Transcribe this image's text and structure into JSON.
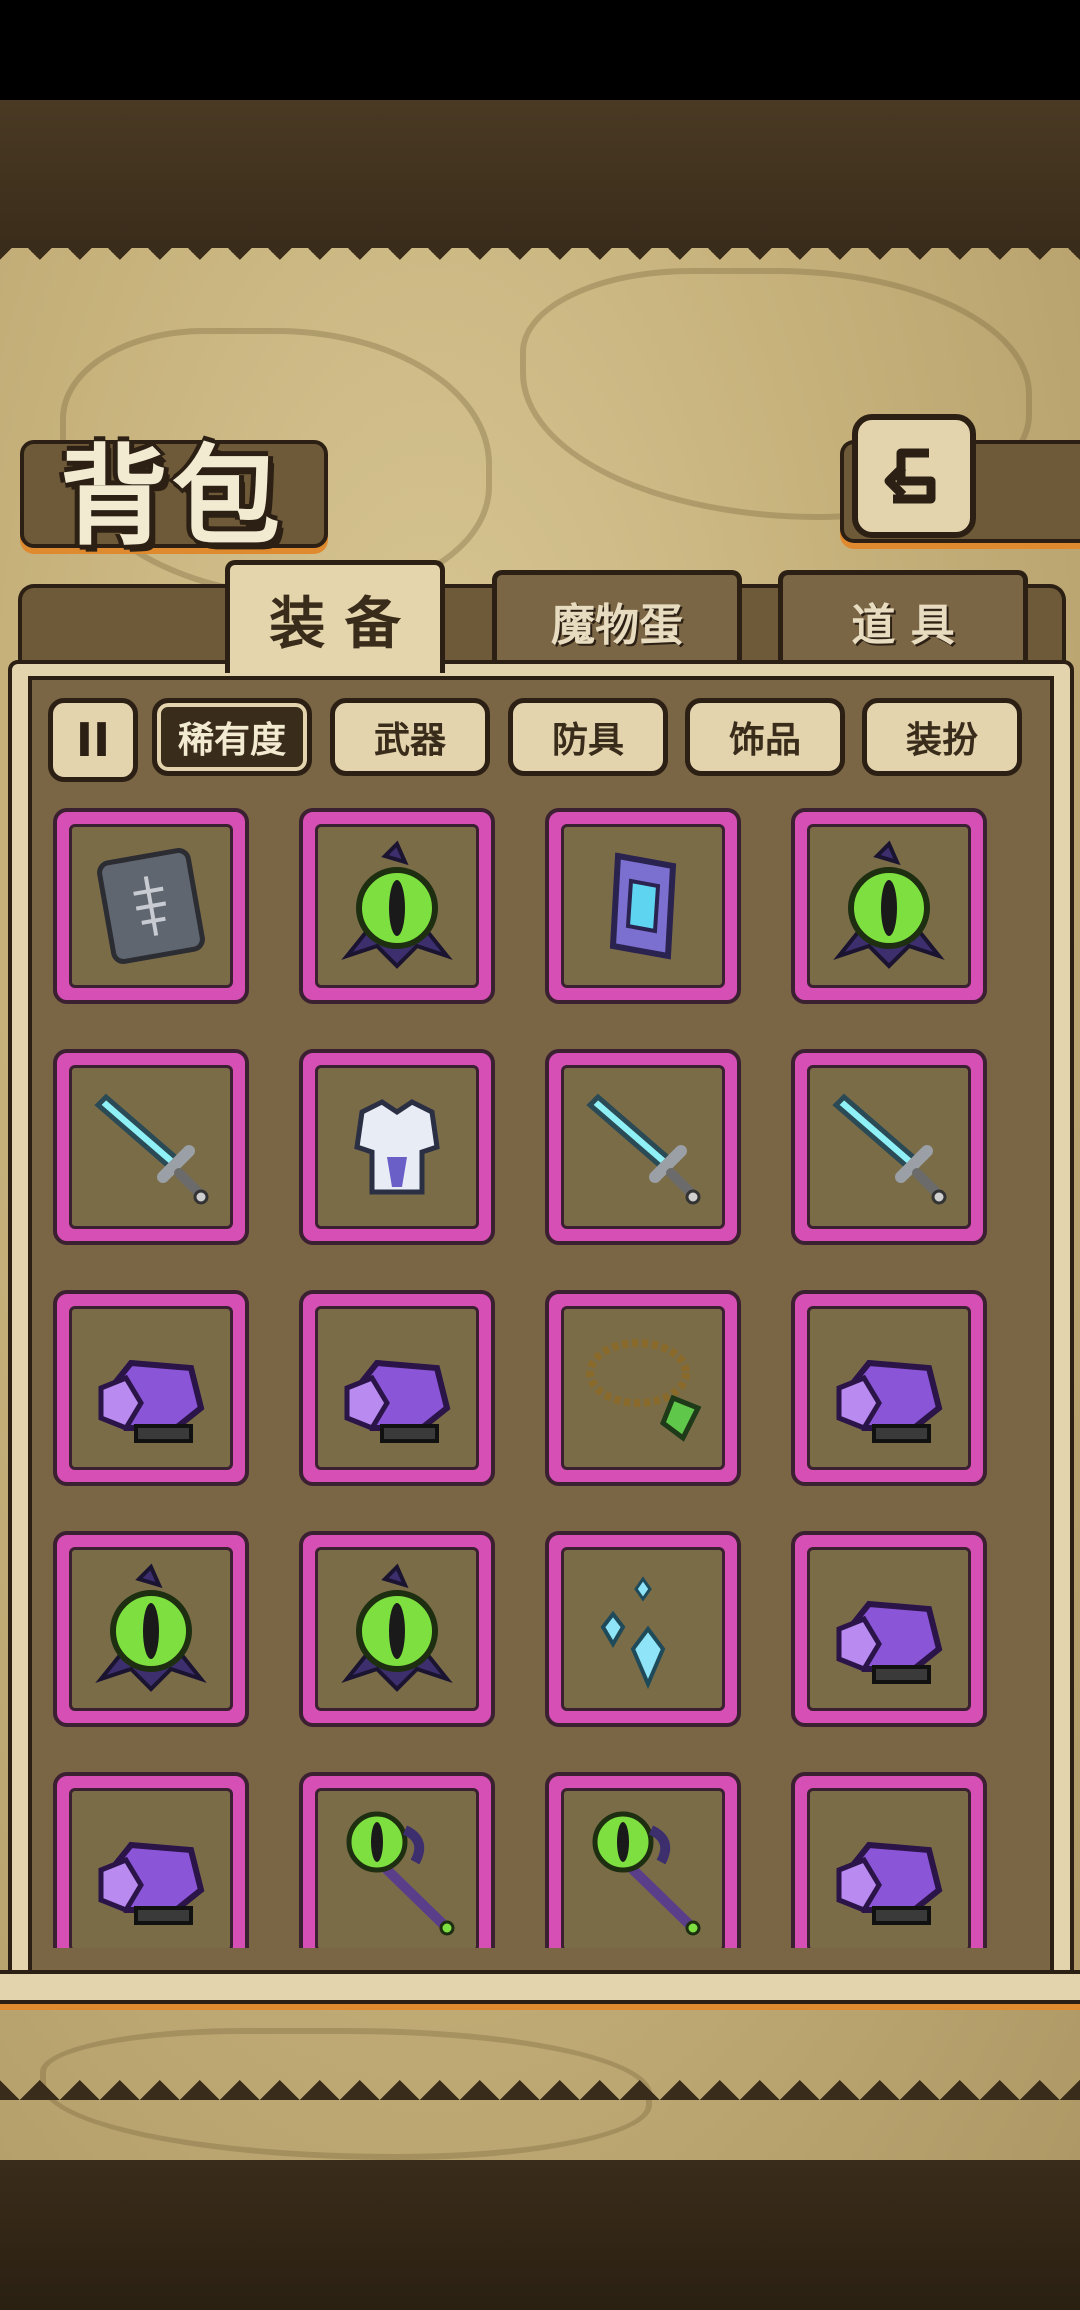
{
  "header": {
    "title": "背包",
    "back_icon": "return-arrow-icon"
  },
  "tabs": [
    {
      "label": "装 备",
      "active": true
    },
    {
      "label": "魔物蛋",
      "active": false
    },
    {
      "label": "道 具",
      "active": false
    }
  ],
  "sort_button": {
    "icon": "sort-toggle-icon",
    "label": "II"
  },
  "filters": [
    {
      "label": "稀有度",
      "active": true
    },
    {
      "label": "武器",
      "active": false
    },
    {
      "label": "防具",
      "active": false
    },
    {
      "label": "饰品",
      "active": false
    },
    {
      "label": "装扮",
      "active": false
    }
  ],
  "colors": {
    "rarity_frame": "#d64fb5",
    "panel": "#7a6545",
    "parchment": "#c7b27c"
  },
  "inventory": [
    {
      "item": "stone-tablet-icon"
    },
    {
      "item": "green-eye-amulet-icon"
    },
    {
      "item": "purple-bracer-icon"
    },
    {
      "item": "green-eye-amulet-icon"
    },
    {
      "item": "crystal-sword-icon"
    },
    {
      "item": "white-armor-icon"
    },
    {
      "item": "crystal-sword-icon"
    },
    {
      "item": "crystal-sword-icon"
    },
    {
      "item": "purple-gauntlet-icon"
    },
    {
      "item": "purple-gauntlet-icon"
    },
    {
      "item": "leaf-necklace-icon"
    },
    {
      "item": "purple-gauntlet-icon"
    },
    {
      "item": "green-eye-amulet-icon"
    },
    {
      "item": "green-eye-amulet-icon"
    },
    {
      "item": "blue-crystal-shards-icon"
    },
    {
      "item": "purple-gauntlet-icon"
    },
    {
      "item": "purple-gauntlet-icon"
    },
    {
      "item": "eye-staff-icon"
    },
    {
      "item": "eye-staff-icon"
    },
    {
      "item": "purple-gauntlet-icon"
    }
  ]
}
